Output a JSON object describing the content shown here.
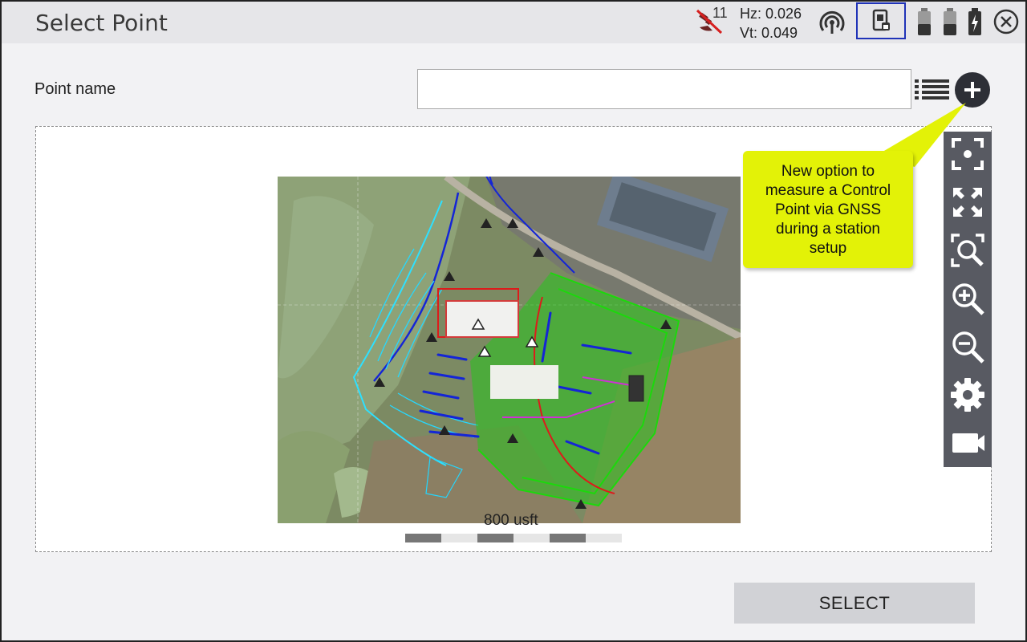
{
  "header": {
    "title": "Select Point",
    "satellites": "11",
    "hz": "Hz: 0.026",
    "vt": "Vt: 0.049"
  },
  "point_name": {
    "label": "Point name",
    "value": "",
    "placeholder": ""
  },
  "map": {
    "scale_label": "800 usft"
  },
  "callout": {
    "text_lines": [
      "New option to",
      "measure a Control",
      "Point via GNSS",
      "during a station",
      "setup"
    ]
  },
  "toolbar": {
    "tools": [
      "zoom-to-extents-icon",
      "fit-icon",
      "zoom-window-icon",
      "zoom-in-icon",
      "zoom-out-icon",
      "settings-icon",
      "camera-icon"
    ]
  },
  "footer": {
    "select_label": "SELECT"
  },
  "colors": {
    "callout": "#e3f207",
    "toolbar": "#585a62",
    "header": "#e6e6e9",
    "instrument_border": "#2033b8"
  }
}
